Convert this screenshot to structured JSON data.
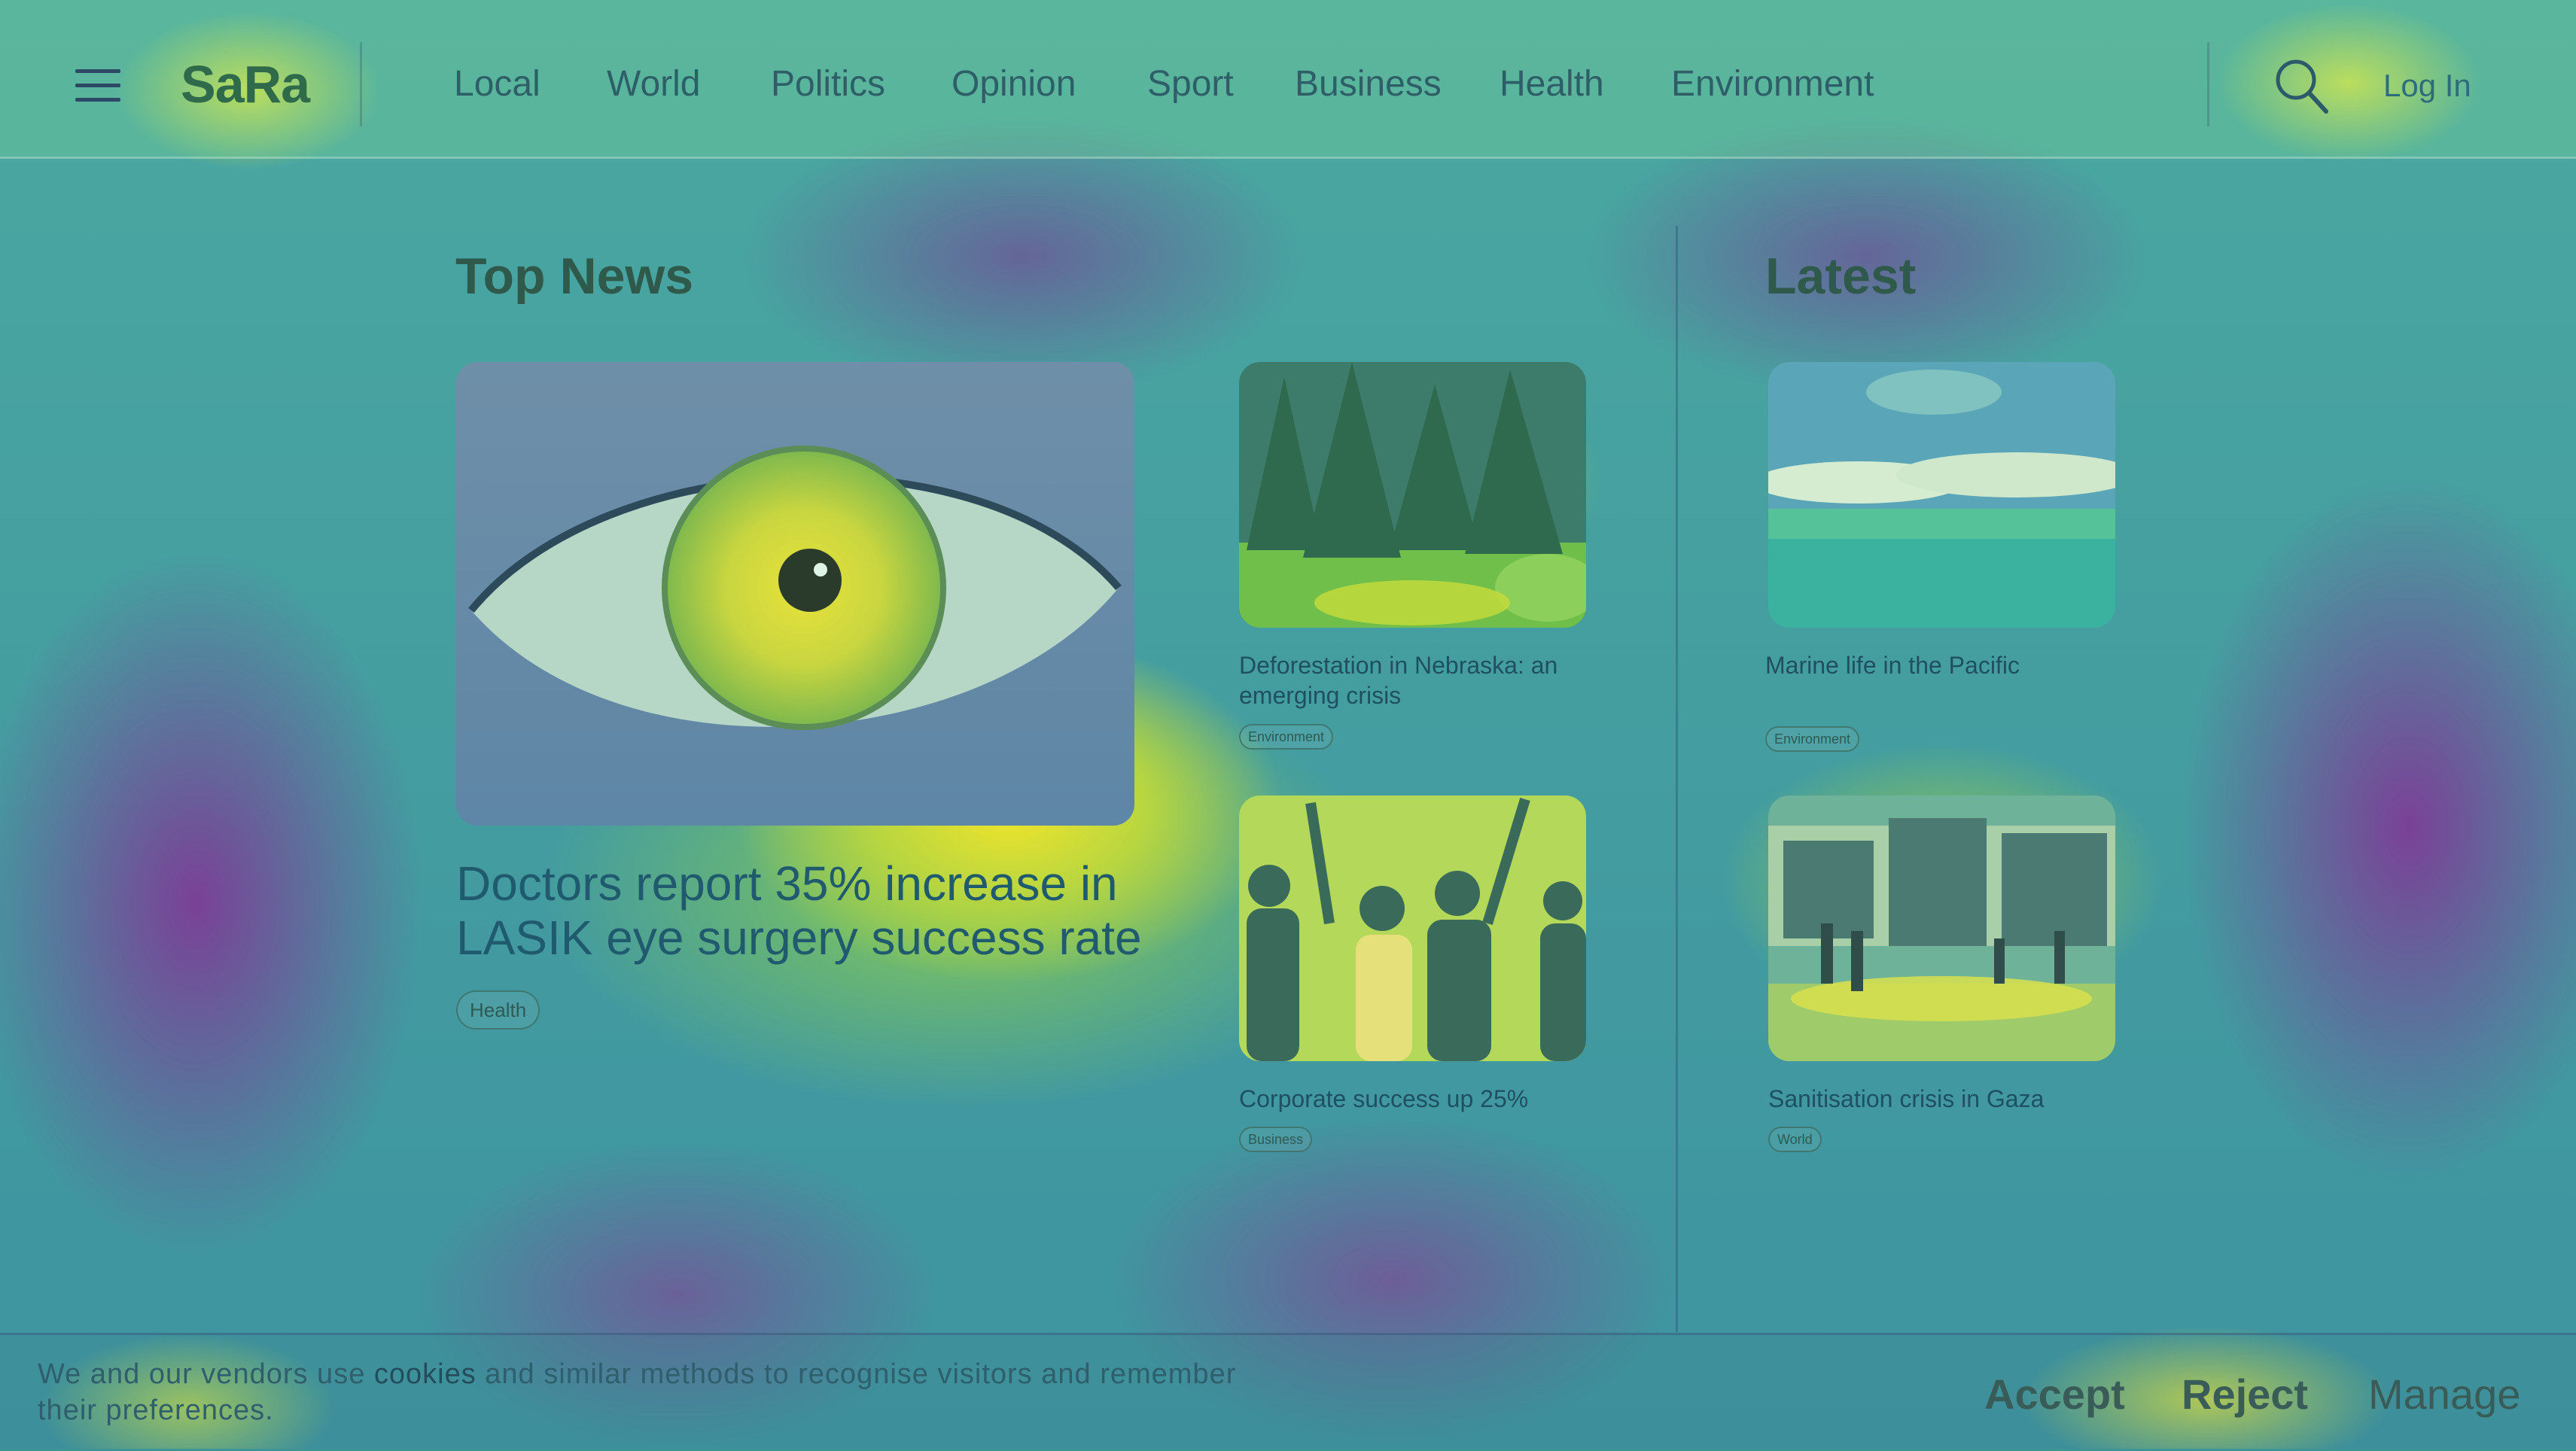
{
  "header": {
    "brand": "SaRa",
    "nav": [
      "Local",
      "World",
      "Politics",
      "Opinion",
      "Sport",
      "Business",
      "Health",
      "Environment"
    ],
    "login": "Log In",
    "icons": {
      "menu": "hamburger-menu-icon",
      "search": "search-icon"
    }
  },
  "top_news": {
    "title": "Top News",
    "feature": {
      "headline_line1": "Doctors report 35% increase in",
      "headline_line2": "LASIK eye surgery success rate",
      "tag": "Health",
      "image": "eye close-up"
    },
    "side": [
      {
        "caption_line1": "Deforestation in Nebraska: an",
        "caption_line2": "emerging crisis",
        "tag": "Environment",
        "image": "forest"
      },
      {
        "caption_line1": "Corporate success up 25%",
        "caption_line2": "",
        "tag": "Business",
        "image": "celebrating team"
      }
    ]
  },
  "latest": {
    "title": "Latest",
    "items": [
      {
        "caption": "Marine life in the Pacific",
        "tag": "Environment",
        "image": "ocean"
      },
      {
        "caption": "Sanitisation crisis in Gaza",
        "tag": "World",
        "image": "camp"
      }
    ]
  },
  "cookie": {
    "text_pre": "We and our vendors use ",
    "text_strong": "cookies",
    "text_post": " and similar methods to recognise visitors and remember their preferences.",
    "accept": "Accept",
    "reject": "Reject",
    "manage": "Manage"
  },
  "colors": {
    "brand": "#2f6a4a",
    "text": "#1f5a6e"
  }
}
